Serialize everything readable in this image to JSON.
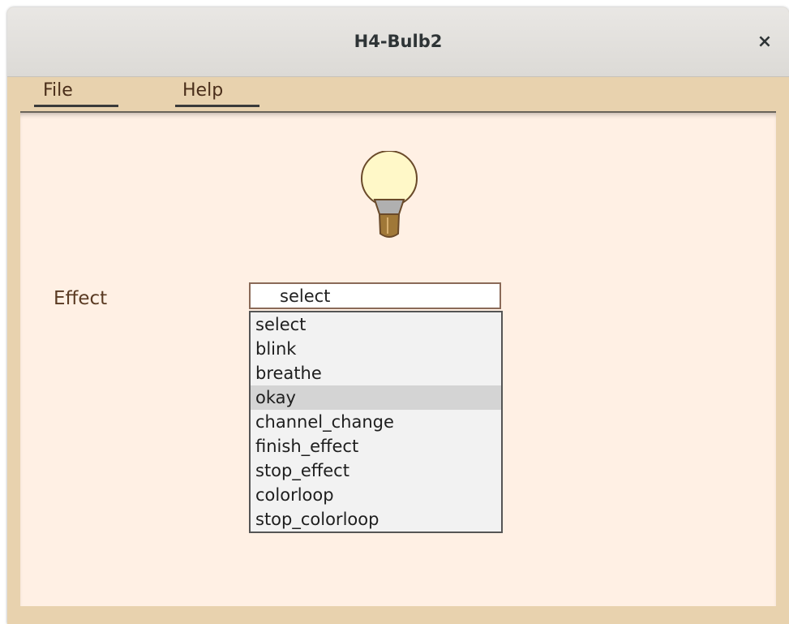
{
  "window": {
    "title": "H4-Bulb2",
    "close_glyph": "×"
  },
  "menu": {
    "items": [
      {
        "label": "File"
      },
      {
        "label": "Help"
      }
    ]
  },
  "bulb": {
    "icon": "light-bulb-icon",
    "glass_color": "#fff8c8",
    "collar_color": "#b0b0b0",
    "base_color": "#a07838"
  },
  "effect": {
    "label": "Effect",
    "selected_value": "select",
    "options": [
      "select",
      "blink",
      "breathe",
      "okay",
      "channel_change",
      "finish_effect",
      "stop_effect",
      "colorloop",
      "stop_colorloop"
    ],
    "highlighted_option": "okay"
  },
  "colors": {
    "frame": "#e8d2ae",
    "content_bg": "#fff0e4",
    "menu_text": "#4a2e1a"
  }
}
